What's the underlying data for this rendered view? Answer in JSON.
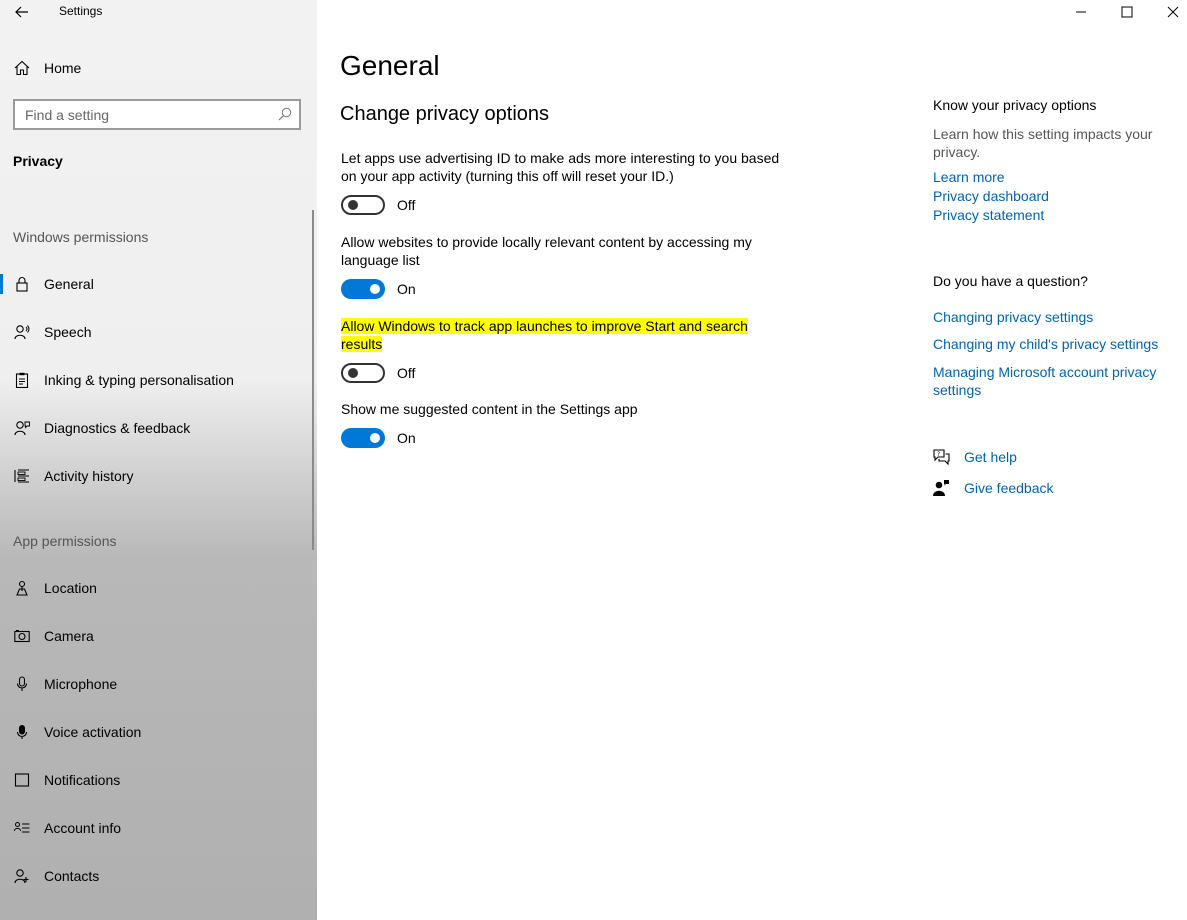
{
  "window": {
    "title": "Settings"
  },
  "sidebar": {
    "home_label": "Home",
    "search_placeholder": "Find a setting",
    "section_title": "Privacy",
    "windows_permissions_header": "Windows permissions",
    "app_permissions_header": "App permissions",
    "windows_permissions": [
      {
        "label": "General",
        "icon": "lock-icon",
        "selected": true
      },
      {
        "label": "Speech",
        "icon": "speech-icon"
      },
      {
        "label": "Inking & typing personalisation",
        "icon": "clipboard-icon"
      },
      {
        "label": "Diagnostics & feedback",
        "icon": "person-feedback-icon"
      },
      {
        "label": "Activity history",
        "icon": "activity-history-icon"
      }
    ],
    "app_permissions": [
      {
        "label": "Location",
        "icon": "location-icon"
      },
      {
        "label": "Camera",
        "icon": "camera-icon"
      },
      {
        "label": "Microphone",
        "icon": "microphone-icon"
      },
      {
        "label": "Voice activation",
        "icon": "voice-activation-icon"
      },
      {
        "label": "Notifications",
        "icon": "notifications-icon"
      },
      {
        "label": "Account info",
        "icon": "account-info-icon"
      },
      {
        "label": "Contacts",
        "icon": "contacts-icon"
      }
    ]
  },
  "main": {
    "title": "General",
    "subtitle": "Change privacy options",
    "settings": [
      {
        "text": "Let apps use advertising ID to make ads more interesting to you based on your app activity (turning this off will reset your ID.)",
        "state": "Off",
        "on": false
      },
      {
        "text": "Allow websites to provide locally relevant content by accessing my language list",
        "state": "On",
        "on": true
      },
      {
        "text": "Allow Windows to track app launches to improve Start and search results",
        "state": "Off",
        "on": false,
        "highlighted": true
      },
      {
        "text": "Show me suggested content in the Settings app",
        "state": "On",
        "on": true
      }
    ]
  },
  "rail": {
    "know_heading": "Know your privacy options",
    "know_desc": "Learn how this setting impacts your privacy.",
    "links": [
      "Learn more",
      "Privacy dashboard",
      "Privacy statement"
    ],
    "question_heading": "Do you have a question?",
    "question_links": [
      "Changing privacy settings",
      "Changing my child's privacy settings",
      "Managing Microsoft account privacy settings"
    ],
    "get_help": "Get help",
    "give_feedback": "Give feedback"
  },
  "colors": {
    "accent": "#0078d7",
    "link": "#0063b1",
    "highlight": "#ffff00"
  }
}
